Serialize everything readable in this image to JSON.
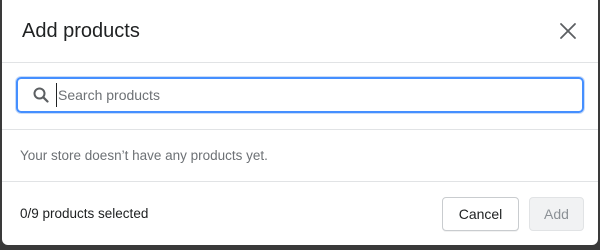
{
  "dialog": {
    "title": "Add products",
    "close_icon": "close-icon"
  },
  "search": {
    "placeholder": "Search products",
    "value": "",
    "icon": "search-icon"
  },
  "empty_state": {
    "message": "Your store doesn’t have any products yet."
  },
  "footer": {
    "selected_count": "0/9 products selected",
    "cancel_label": "Cancel",
    "add_label": "Add"
  },
  "colors": {
    "focus_ring": "#458fff",
    "text_primary": "#202223",
    "text_subdued": "#6d7175",
    "border": "#e1e3e5",
    "disabled_bg": "#f1f2f3",
    "disabled_text": "#8c9196"
  }
}
